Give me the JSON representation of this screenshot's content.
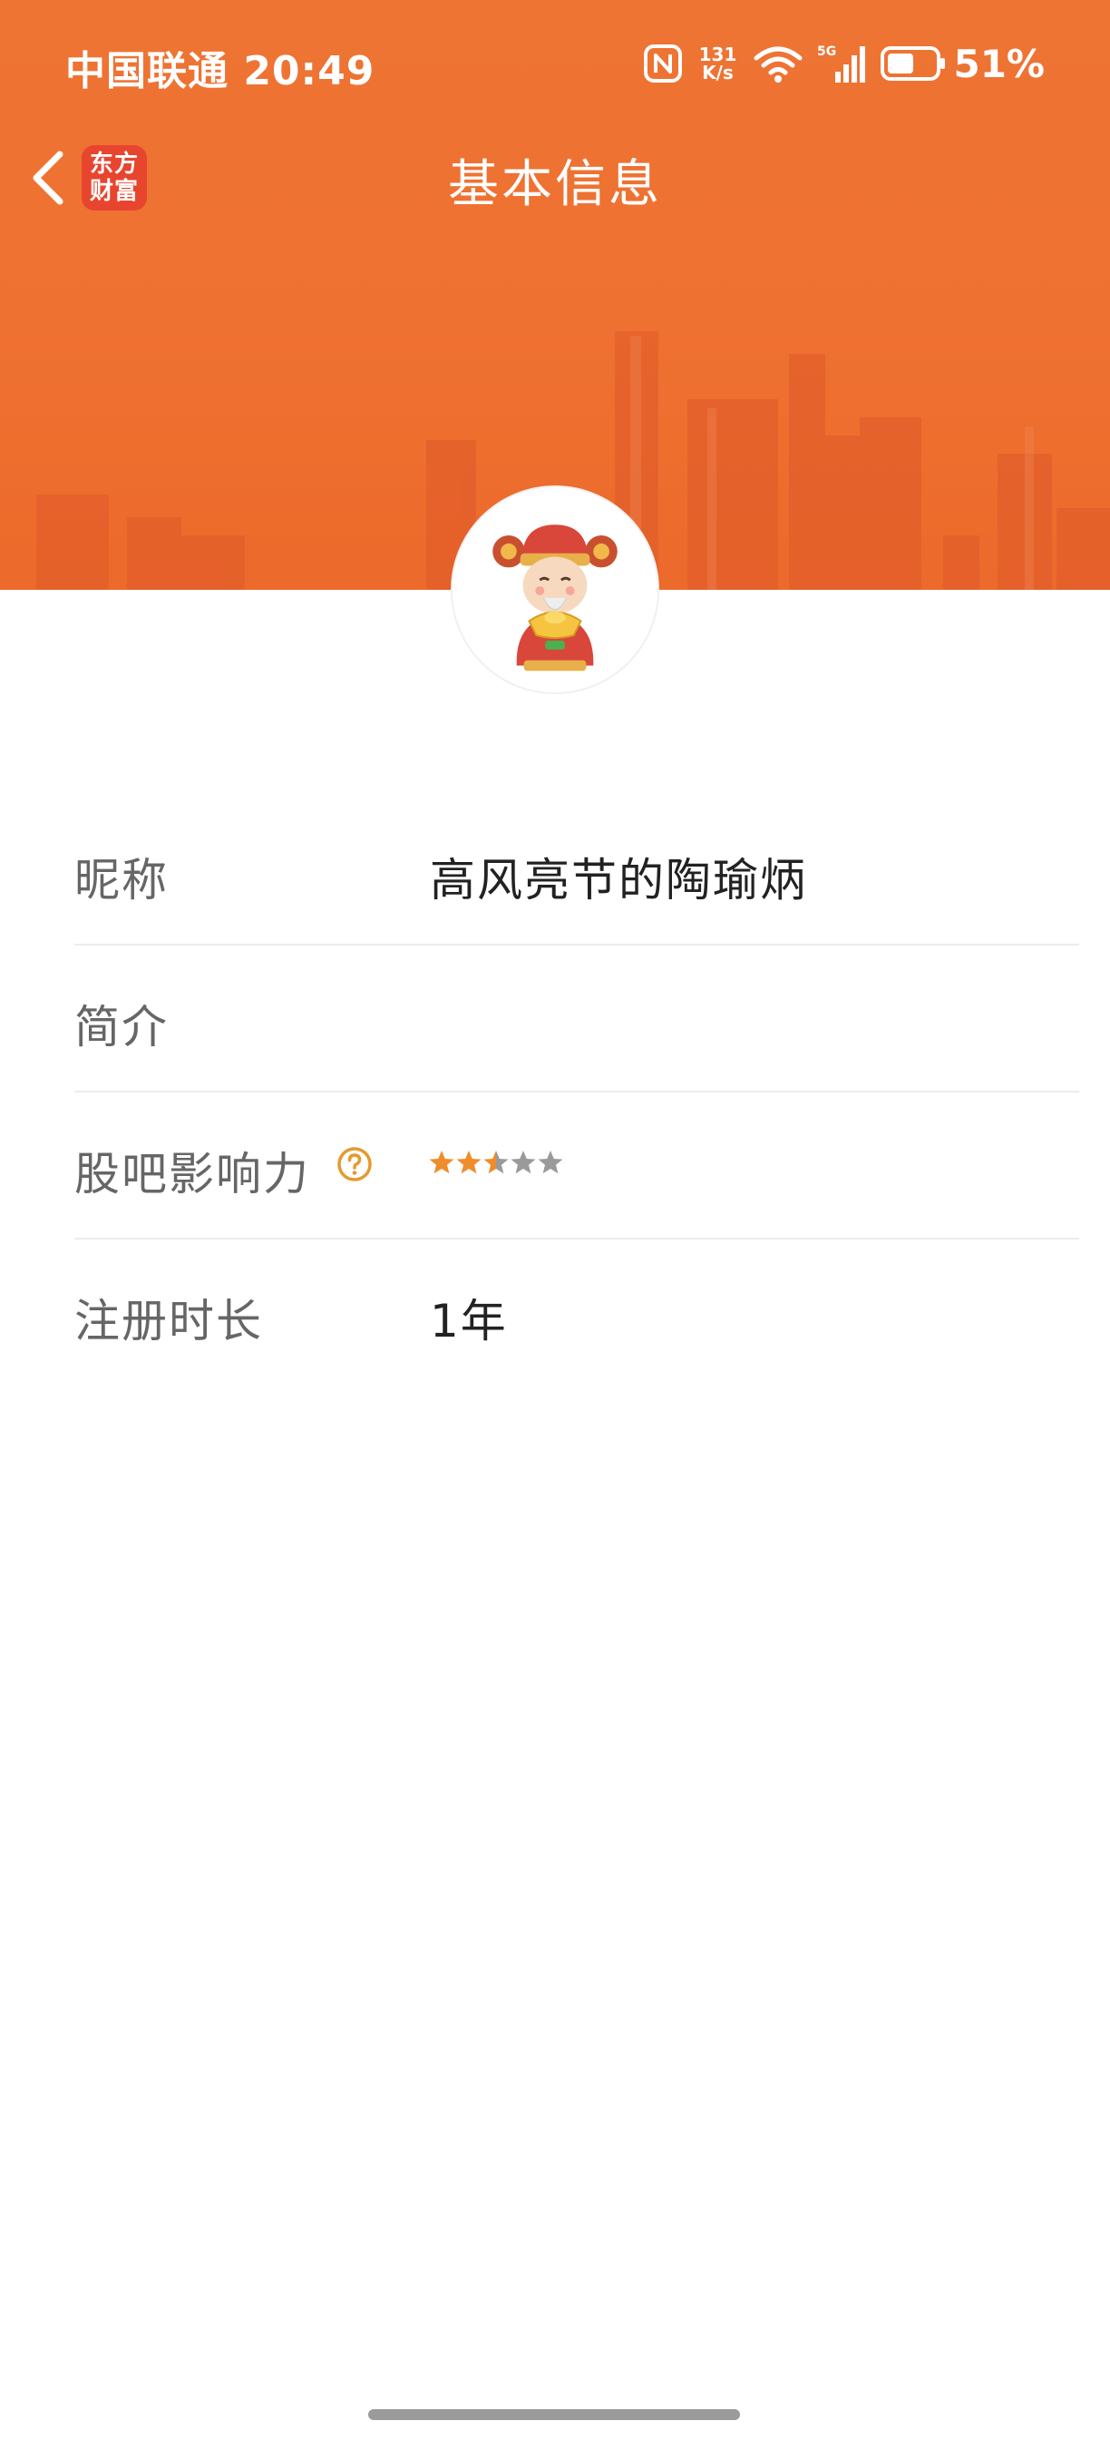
{
  "statusbar": {
    "carrier_time": "中国联通 20:49",
    "net_speed_value": "131",
    "net_speed_unit": "K/s",
    "network": "5G",
    "battery": "51%"
  },
  "navbar": {
    "title": "基本信息",
    "app_logo_line1": "东方",
    "app_logo_line2": "财富"
  },
  "profile": {
    "rows": [
      {
        "label": "昵称",
        "value": "高风亮节的陶瑜炳"
      },
      {
        "label": "简介",
        "value": ""
      },
      {
        "label": "股吧影响力",
        "rating": 2.5,
        "rating_max": 5
      },
      {
        "label": "注册时长",
        "value": "1年"
      }
    ]
  },
  "colors": {
    "header_orange": "#ee7434",
    "star_active": "#ef8c2c",
    "star_inactive": "#9a9a9a",
    "help_icon": "#e59a2e"
  }
}
